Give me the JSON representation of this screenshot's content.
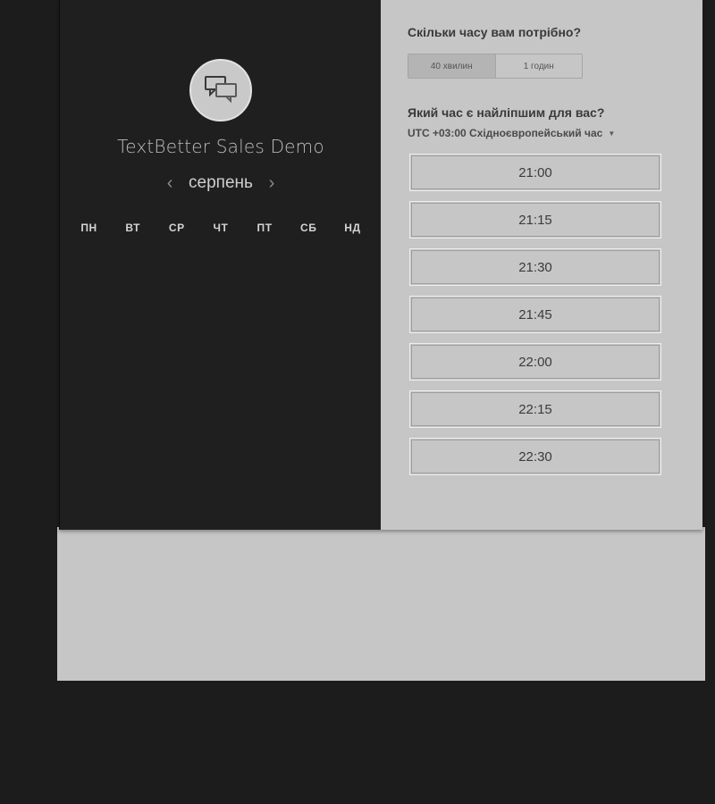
{
  "organizer": {
    "name": "TextBetter Sales Demo",
    "avatar_icon": "chat-bubbles-icon"
  },
  "calendar": {
    "month": "серпень",
    "prev_icon": "chevron-left-icon",
    "next_icon": "chevron-right-icon",
    "prev_symbol": "‹",
    "next_symbol": "›",
    "weekdays": [
      "ПН",
      "ВТ",
      "СР",
      "ЧТ",
      "ПТ",
      "СБ",
      "НД"
    ]
  },
  "duration": {
    "question": "Скільки часу вам потрібно?",
    "options": [
      "40 хвилин",
      "1 годин"
    ],
    "selected": "40 хвилин"
  },
  "time_selection": {
    "question": "Який час є найліпшим для вас?",
    "timezone": "UTC +03:00 Східноєвропейський час",
    "slots": [
      "21:00",
      "21:15",
      "21:30",
      "21:45",
      "22:00",
      "22:15",
      "22:30"
    ]
  },
  "colors": {
    "left_panel": "#1f1f1f",
    "right_panel": "#c6c6c6",
    "page_background": "#1c1c1c"
  }
}
